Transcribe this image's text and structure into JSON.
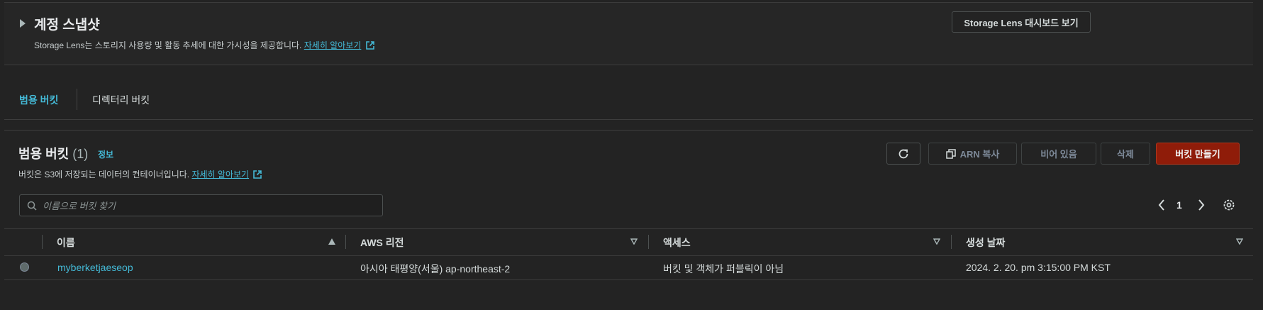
{
  "snapshot": {
    "title": "계정 스냅샷",
    "description_prefix": "Storage Lens는 스토리지 사용량 및 활동 추세에 대한 가시성을 제공합니다.",
    "learn_more": "자세히 알아보기",
    "dashboard_button": "Storage Lens 대시보드 보기"
  },
  "tabs": [
    {
      "label": "범용 버킷",
      "active": true
    },
    {
      "label": "디렉터리 버킷",
      "active": false
    }
  ],
  "buckets": {
    "title": "범용 버킷",
    "count": "(1)",
    "info": "정보",
    "description_prefix": "버킷은 S3에 저장되는 데이터의 컨테이너입니다.",
    "learn_more": "자세히 알아보기",
    "search_placeholder": "이름으로 버킷 찾기",
    "page": "1"
  },
  "toolbar": {
    "refresh_icon": "refresh-icon",
    "copy_arn": "ARN 복사",
    "empty": "비어 있음",
    "delete": "삭제",
    "create": "버킷 만들기"
  },
  "table": {
    "columns": [
      "이름",
      "AWS 리전",
      "액세스",
      "생성 날짜"
    ],
    "rows": [
      {
        "name": "myberketjaeseop",
        "region": "아시아 태평양(서울) ap-northeast-2",
        "access": "버킷 및 객체가 퍼블릭이 아님",
        "created": "2024. 2. 20. pm 3:15:00 PM KST"
      }
    ]
  },
  "colors": {
    "background": "#232323",
    "accent_link": "#44b9d6",
    "primary_button": "#8f1c09"
  }
}
